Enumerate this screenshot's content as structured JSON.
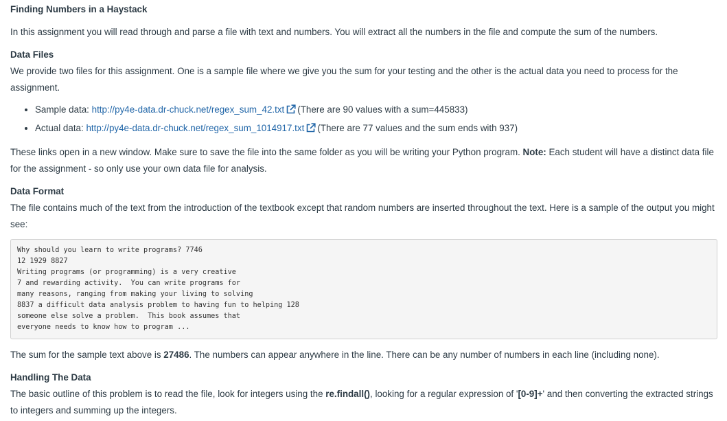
{
  "title": "Finding Numbers in a Haystack",
  "intro": "In this assignment you will read through and parse a file with text and numbers. You will extract all the numbers in the file and compute the sum of the numbers.",
  "data_files": {
    "heading": "Data Files",
    "text": "We provide two files for this assignment. One is a sample file where we give you the sum for your testing and the other is the actual data you need to process for the assignment.",
    "items": [
      {
        "label": "Sample data: ",
        "link": "http://py4e-data.dr-chuck.net/regex_sum_42.txt",
        "note": "(There are 90 values with a sum=445833)"
      },
      {
        "label": "Actual data: ",
        "link": "http://py4e-data.dr-chuck.net/regex_sum_1014917.txt",
        "note": "(There are 77 values and the sum ends with 937)"
      }
    ],
    "after_pre": "These links open in a new window. Make sure to save the file into the same folder as you will be writing your Python program. ",
    "note_label": "Note:",
    "after_note": " Each student will have a distinct data file for the assignment - so only use your own data file for analysis."
  },
  "data_format": {
    "heading": "Data Format",
    "text": "The file contains much of the text from the introduction of the textbook except that random numbers are inserted throughout the text. Here is a sample of the output you might see:",
    "sample": "Why should you learn to write programs? 7746\n12 1929 8827\nWriting programs (or programming) is a very creative\n7 and rewarding activity.  You can write programs for\nmany reasons, ranging from making your living to solving\n8837 a difficult data analysis problem to having fun to helping 128\nsomeone else solve a problem.  This book assumes that\neveryone needs to know how to program ...",
    "sum_pre": "The sum for the sample text above is ",
    "sum_value": "27486",
    "sum_post": ". The numbers can appear anywhere in the line. There can be any number of numbers in each line (including none)."
  },
  "handling": {
    "heading": "Handling The Data",
    "pre": "The basic outline of this problem is to read the file, look for integers using the ",
    "func": "re.findall()",
    "mid": ", looking for a regular expression of '",
    "regex": "[0-9]+",
    "post": "' and then converting the extracted strings to integers and summing up the integers."
  },
  "colors": {
    "text": "#2d3b45",
    "link": "#2166a8",
    "code_bg": "#f5f5f5"
  },
  "icons": {
    "external_link": "external-link-icon"
  }
}
